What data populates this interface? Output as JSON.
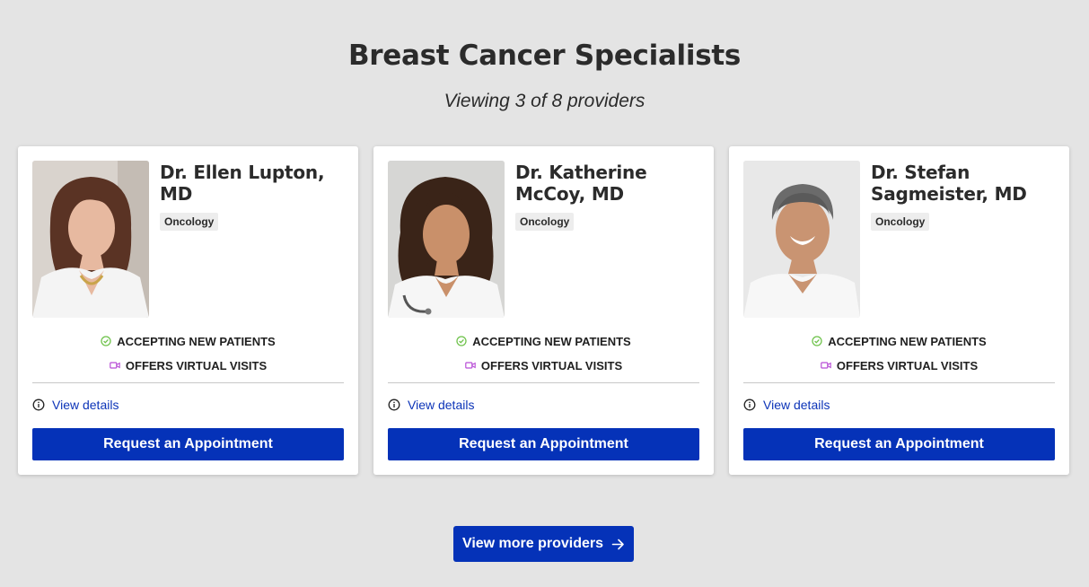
{
  "heading": "Breast Cancer Specialists",
  "subheading": "Viewing 3 of 8 providers",
  "colors": {
    "primary": "#0532b8",
    "accept": "#6ec24a",
    "virtual": "#b84ed6",
    "link": "#0c34b8"
  },
  "providers": [
    {
      "name": "Dr. Ellen Lupton, MD",
      "specialty": "Oncology",
      "accepting": "ACCEPTING NEW PATIENTS",
      "virtual": "OFFERS VIRTUAL VISITS",
      "details": "View details",
      "cta": "Request an Appointment"
    },
    {
      "name": "Dr. Katherine McCoy, MD",
      "specialty": "Oncology",
      "accepting": "ACCEPTING NEW PATIENTS",
      "virtual": "OFFERS VIRTUAL VISITS",
      "details": "View details",
      "cta": "Request an Appointment"
    },
    {
      "name": "Dr. Stefan Sagmeister, MD",
      "specialty": "Oncology",
      "accepting": "ACCEPTING NEW PATIENTS",
      "virtual": "OFFERS VIRTUAL VISITS",
      "details": "View details",
      "cta": "Request an Appointment"
    }
  ],
  "more_button": {
    "label": "View more providers",
    "icon": "arrow-right-icon"
  }
}
